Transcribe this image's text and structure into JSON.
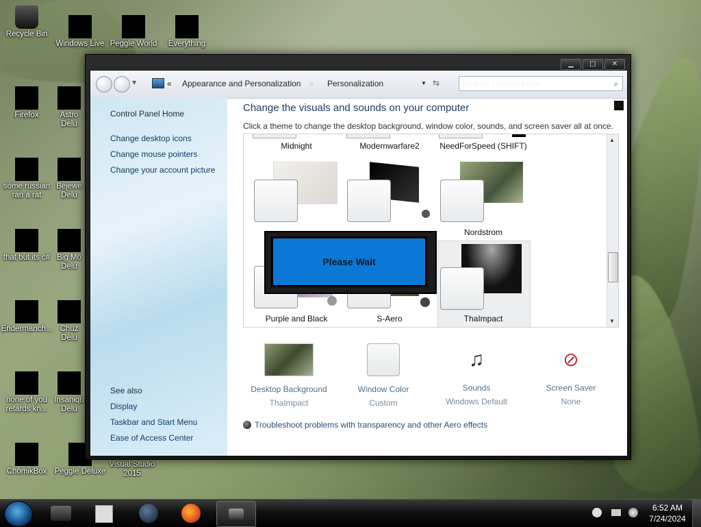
{
  "desktop": {
    "icons": [
      {
        "label": "Recycle Bin"
      },
      {
        "label": "Windows Live Mail"
      },
      {
        "label": "Peggle World of Warcraft"
      },
      {
        "label": "Everything"
      },
      {
        "label": "Firefox"
      },
      {
        "label": "Astro Delu"
      },
      {
        "label": "some russian ran a rat"
      },
      {
        "label": "Bejewe Delu"
      },
      {
        "label": "that but its c#"
      },
      {
        "label": "Big Mo Delu"
      },
      {
        "label": "Endermanch..."
      },
      {
        "label": "Chuz Delu"
      },
      {
        "label": "none of you retards kn..."
      },
      {
        "label": "Insaniqu Delu"
      },
      {
        "label": "ChomikBox"
      },
      {
        "label": "Peggle Deluxe"
      },
      {
        "label": "Visual Studio 2015"
      }
    ]
  },
  "window": {
    "controls": {
      "minimize": "▁",
      "maximize": "□",
      "close": "✕"
    },
    "address": {
      "chevron": "«",
      "crumb1": "Appearance and Personalization",
      "crumb2": "Personalization"
    },
    "search_placeholder": "Search Control Panel"
  },
  "sidebar": {
    "home": "Control Panel Home",
    "links": [
      "Change desktop icons",
      "Change mouse pointers",
      "Change your account picture"
    ],
    "see_also_header": "See also",
    "see_also": [
      "Display",
      "Taskbar and Start Menu",
      "Ease of Access Center"
    ]
  },
  "main": {
    "title": "Change the visuals and sounds on your computer",
    "description": "Click a theme to change the desktop background, window color, sounds, and screen saver all at once.",
    "themes_top_row": [
      "Midnight",
      "Modernwarfare2",
      "NeedForSpeed (SHIFT)"
    ],
    "themes_mid_row": [
      "Nordstrom"
    ],
    "themes_bottom_row": [
      "Purple and Black",
      "S-Aero",
      "ThaImpact"
    ],
    "settings": [
      {
        "name": "Desktop Background",
        "value": "ThaImpact",
        "icon": "desktop-background-icon"
      },
      {
        "name": "Window Color",
        "value": "Custom",
        "icon": "window-color-icon"
      },
      {
        "name": "Sounds",
        "value": "Windows Default",
        "icon": "sounds-icon"
      },
      {
        "name": "Screen Saver",
        "value": "None",
        "icon": "screen-saver-icon"
      }
    ],
    "troubleshoot": "Troubleshoot problems with transparency and other Aero effects"
  },
  "dialog": {
    "text": "Please Wait"
  },
  "taskbar": {
    "time": "6:52 AM",
    "date": "7/24/2024"
  },
  "colors": {
    "dialog_blue": "#0a78d4",
    "link_blue": "#133a6a"
  }
}
